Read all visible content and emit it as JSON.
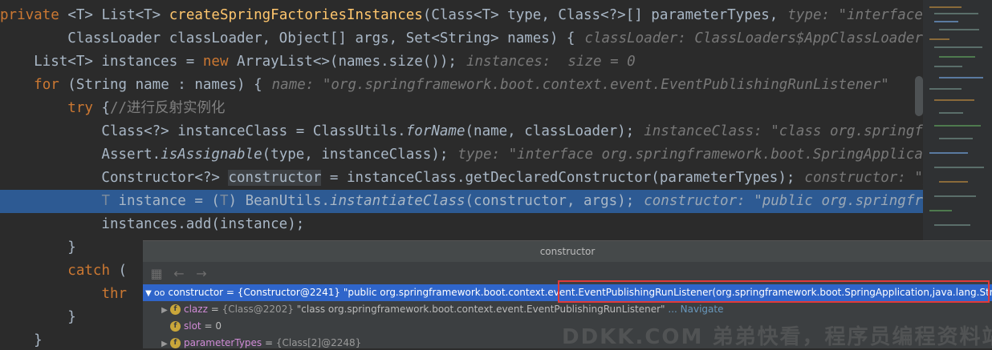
{
  "code": {
    "l1": {
      "kw": "private",
      "g1": "<T> List<T> ",
      "fn": "createSpringFactoriesInstances",
      "rest": "(Class<T> type, Class<?>[] parameterTypes,",
      "hint": "type: \"interface org...\""
    },
    "l2": {
      "code": "        ClassLoader classLoader, Object[] args, Set<String> names) {",
      "hint": "classLoader: ClassLoaders$AppClassLoader"
    },
    "l3": {
      "a": "    List<T> instances = ",
      "kw": "new",
      "b": " ArrayList<>(names.size());",
      "hint": "instances:  size = 0"
    },
    "l4": {
      "kw": "for",
      "b": " (String name : names) {",
      "hint": "name: \"org.springframework.boot.context.event.EventPublishingRunListener\""
    },
    "l5": {
      "kw": "try",
      "b": " {",
      "cm": "//进行反射实例化"
    },
    "l6": {
      "a": "            Class<?> instanceClass = ClassUtils.",
      "it": "forName",
      "b": "(name, classLoader);",
      "hint": "instanceClass: \"class org.springframework\""
    },
    "l7": {
      "a": "            Assert.",
      "it": "isAssignable",
      "b": "(type, instanceClass);",
      "hint": "type: \"interface org.springframework.boot.SpringApplicationRunListener\""
    },
    "l8": {
      "a": "            Constructor<?> ",
      "sel": "constructor",
      "b": " = instanceClass.getDeclaredConstructor(parameterTypes);",
      "hint": "constructor: \"public\""
    },
    "l9": {
      "t": "T",
      "a": " instance = (",
      "t2": "T",
      "b": ") BeanUtils.",
      "it": "instantiateClass",
      "c": "(constructor, args);",
      "hint": "constructor: \"public org.springframework\""
    },
    "l10": {
      "code": "            instances.add(instance);"
    },
    "l11": {
      "code": "        }"
    },
    "l12": {
      "kw": "catch",
      "b": " ("
    },
    "l13": {
      "kw": "thr"
    },
    "l14": {
      "code": "        }"
    },
    "l15": {
      "code": "    }"
    }
  },
  "popup": {
    "title": "constructor",
    "rows": [
      {
        "name": "constructor",
        "eq": " = ",
        "ref": "{Constructor@2241}",
        "value": " \"public org.springframework.boot.context.event.EventPublishingRunListener(org.springframework.boot.SpringApplication,java.lang.String[])\""
      },
      {
        "name": "clazz",
        "eq": " = ",
        "ref": "{Class@2202}",
        "value": " \"class org.springframework.boot.context.event.EventPublishingRunListener\"",
        "link": " ... Navigate"
      },
      {
        "name": "slot",
        "eq": " = ",
        "ref": "",
        "value": "0"
      },
      {
        "name": "parameterTypes",
        "eq": " = ",
        "ref": "{Class[2]@2248}",
        "value": ""
      }
    ]
  },
  "watermark": "DDKK.COM 弟弟快看，程序员编程资料站",
  "colors": {
    "background": "#2b2b2b",
    "keyword": "#cc7832",
    "method": "#ffc66d",
    "highlight": "#2d5a93",
    "selection": "#2f65ca",
    "redbox": "#e03a3a"
  }
}
